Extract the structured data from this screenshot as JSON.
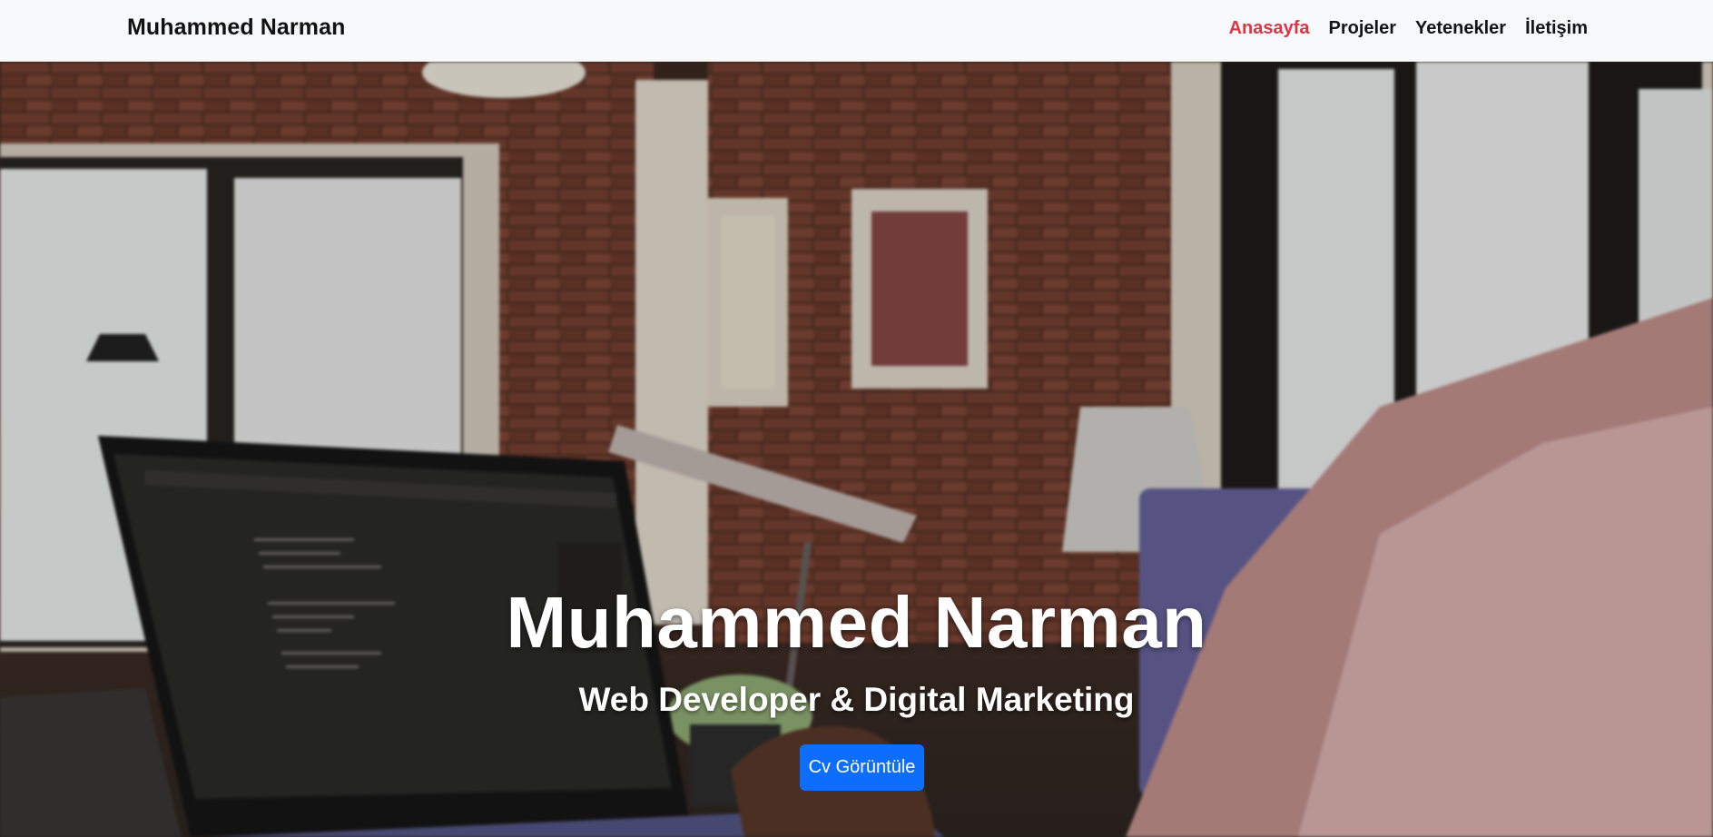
{
  "nav": {
    "brand": "Muhammed Narman",
    "links": [
      {
        "label": "Anasayfa",
        "active": true
      },
      {
        "label": "Projeler",
        "active": false
      },
      {
        "label": "Yetenekler",
        "active": false
      },
      {
        "label": "İletişim",
        "active": false
      }
    ]
  },
  "hero": {
    "title": "Muhammed Narman",
    "subtitle": "Web Developer & Digital Marketing",
    "cv_button": "Cv Görüntüle",
    "background_image": "home-office-with-laptop-code-editor-brick-wall-photo"
  },
  "colors": {
    "nav_bg": "#f8f9fa",
    "active_link": "#dc3545",
    "button_bg": "#0d6efd",
    "text_light": "#ffffff"
  }
}
